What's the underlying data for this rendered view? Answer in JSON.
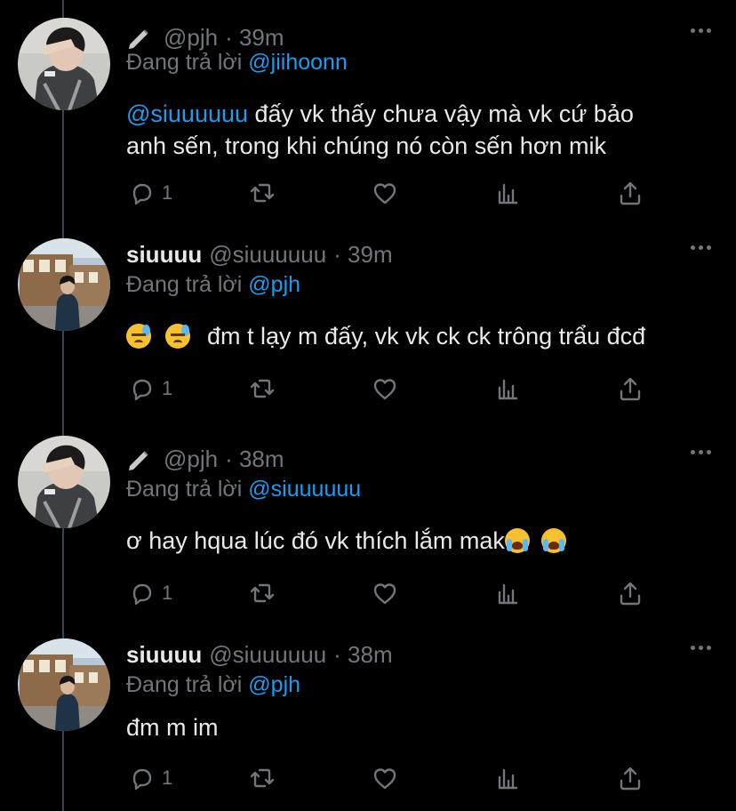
{
  "accent": "#1d9bf0",
  "tweets": [
    {
      "display_name": "",
      "handle": "@pjh",
      "time": "· 39m",
      "reply_prefix": "Đang trả lời",
      "reply_to": "@jiihoonn",
      "line1_mention": "@siuuuuuu",
      "line1": " đấy vk thấy chưa vậy mà vk cứ bảo",
      "line2": "anh sến, trong khi chúng nó còn sến hơn mik",
      "reply_count": "1",
      "avatar": "user-pjh"
    },
    {
      "display_name": "siuuuu",
      "handle": "@siuuuuuu",
      "time": "· 39m",
      "reply_prefix": "Đang trả lời",
      "reply_to": "@pjh",
      "line1": "đm t lạy m đấy, vk vk ck ck trông trẩu đcđ",
      "emojis": [
        "downcast-face-with-sweat",
        "downcast-face-with-sweat"
      ],
      "reply_count": "1",
      "avatar": "user-siuuuu"
    },
    {
      "display_name": "",
      "handle": "@pjh",
      "time": "· 38m",
      "reply_prefix": "Đang trả lời",
      "reply_to": "@siuuuuuu",
      "line1": "ơ hay hqua lúc đó vk thích lắm mak",
      "emojis": [
        "loudly-crying-face",
        "loudly-crying-face"
      ],
      "reply_count": "1",
      "avatar": "user-pjh"
    },
    {
      "display_name": "siuuuu",
      "handle": "@siuuuuuu",
      "time": "· 38m",
      "reply_prefix": "Đang trả lời",
      "reply_to": "@pjh",
      "line1": "đm m im",
      "reply_count": "1",
      "avatar": "user-siuuuu"
    }
  ]
}
